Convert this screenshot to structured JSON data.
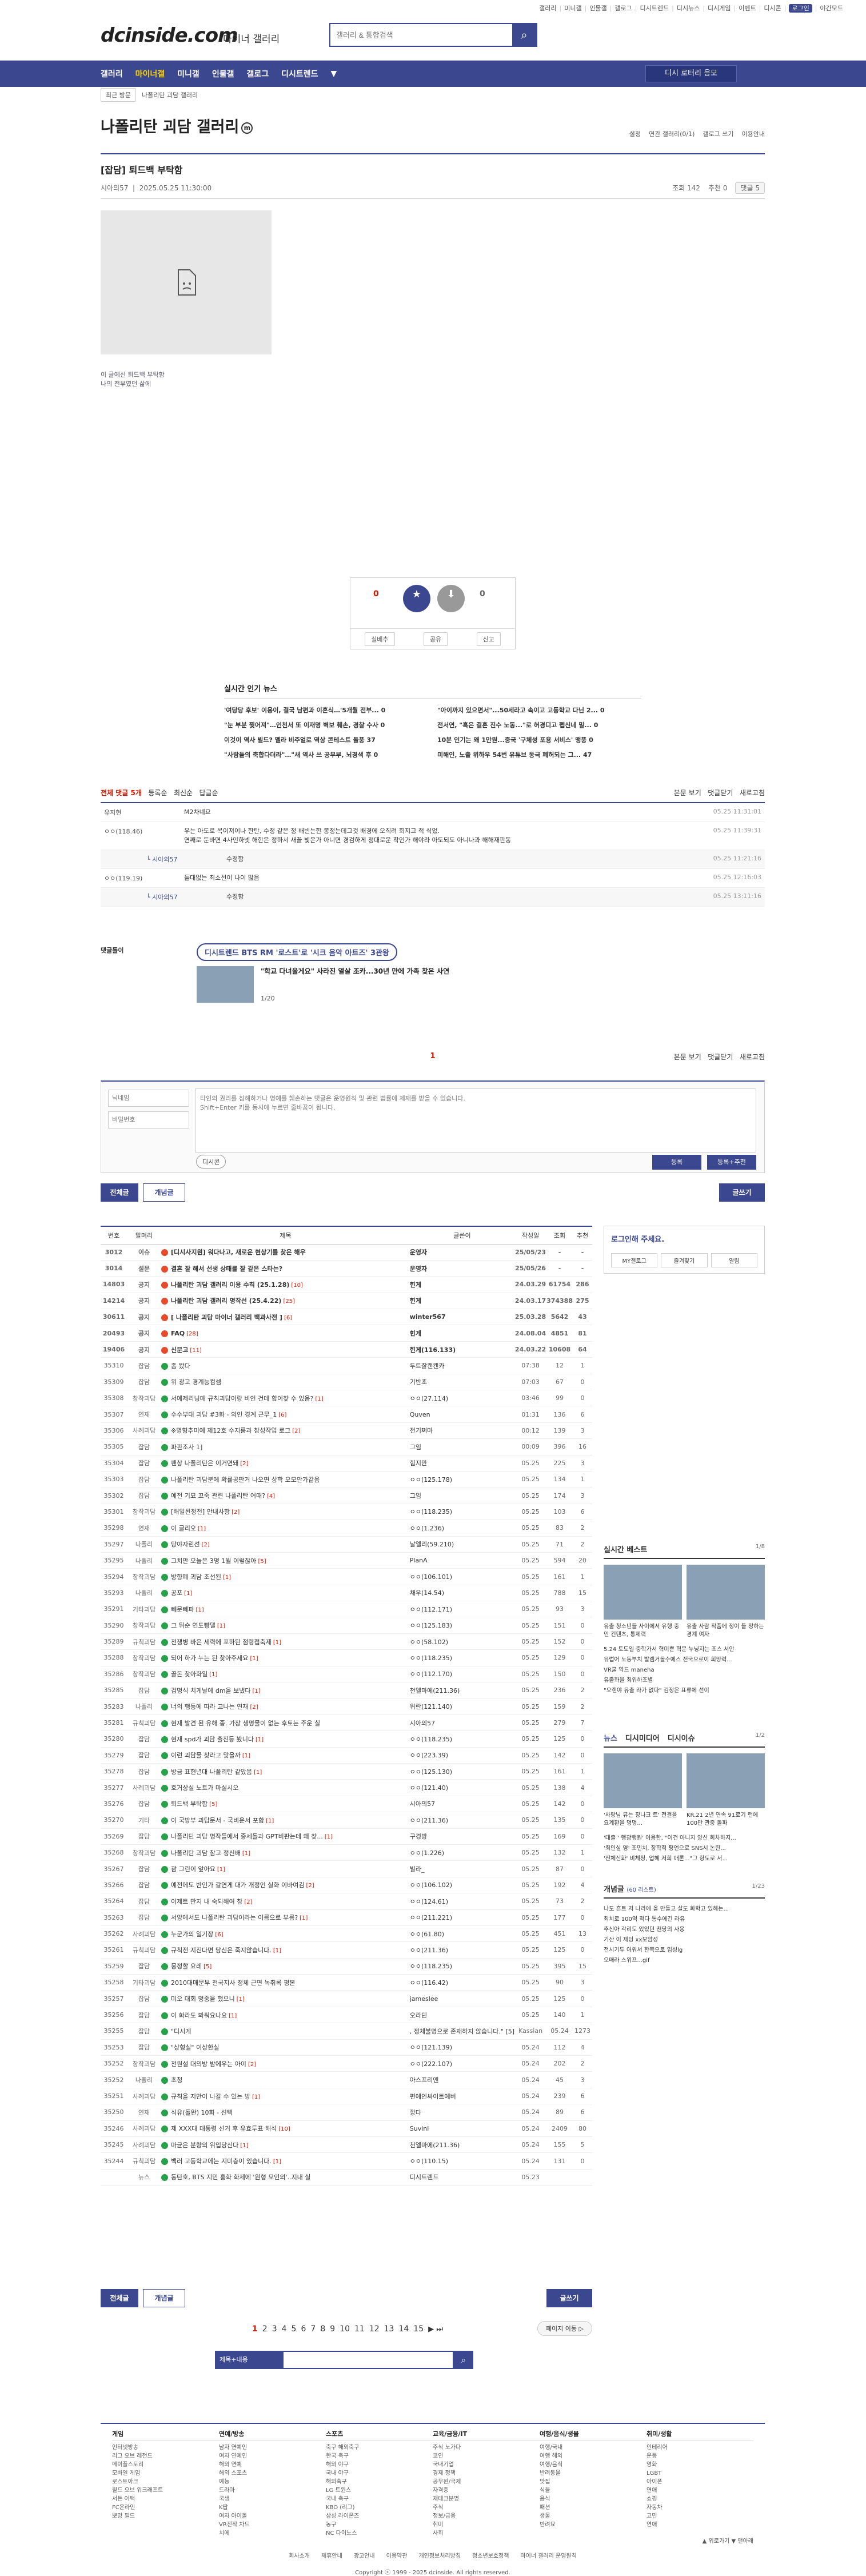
{
  "util": [
    "갤러리",
    "미니갤",
    "인물갤",
    "갤로그",
    "디시트렌드",
    "디시뉴스",
    "디시게임",
    "이벤트",
    "디시콘",
    "로그인",
    "야간모드"
  ],
  "header": {
    "logo": "dcinside.com",
    "logo_sub": "마이너 갤러리",
    "search_placeholder": "갤러리 & 통합검색"
  },
  "gnb": {
    "items": [
      "갤러리",
      "마이너갤",
      "미니갤",
      "인물갤",
      "갤로그",
      "디시트렌드"
    ],
    "more": "▼",
    "ballot": "디시 로터리 응모"
  },
  "sub": {
    "recent": "최근 방문",
    "gall": "나폴리탄 괴담 갤러리"
  },
  "gall": {
    "title": "나폴리탄 괴담 갤러리",
    "badge": "m",
    "opt1": "설정",
    "opt2": "연관 갤러리(0/1)",
    "opt3": "갤로그 쓰기",
    "opt4": "이용안내"
  },
  "post": {
    "title": "[잡담] 퇴드백 부탁함",
    "author": "시아의57",
    "date": "2025.05.25 11:30:00",
    "views": "조회 142",
    "recs": "추천 0",
    "cmts": "댓글 5",
    "caption1": "이 글에선 퇴드백 부탁함",
    "caption2": "나의 전부였던 삶에"
  },
  "rec": {
    "up_count": "0",
    "down_count": "0",
    "up_label": "개념",
    "down_label": "비추",
    "share": "공유",
    "report": "신고",
    "recent": "실베추"
  },
  "news": {
    "title": "실시간 인기 뉴스",
    "items": [
      "'여당당 후보' 이용이, 결국 남편과 이혼식…'5개월 전부... 0",
      "\"눈 부분 찢어져\"…인천서 또 이재명 벽보 훼손, 경찰 수사 0",
      "이것이 역사 빌드? 멜라 비주얼로 역상 콘테스트 돌풍 37",
      "\"사람들의 축합다더라\"…\"새 역사 쓰 공무부, 뇌경색 후 0",
      "\"아이까지 있으면서\"...50세라고 속이고 고등학교 다닌 2... 0",
      "전서연, \"혹은 결혼 진수 노동...\"로 허경디고 펩신네 밀... 0",
      "10분 인기는 왜 1만원...중국 '구체성 포용 서비스' 맹풍 0",
      "미해인, 노출 위하우 54번 유튜브 동극 폐허되는 그... 47"
    ]
  },
  "cmt": {
    "head": "전체 댓글 5개",
    "opt1": "등록순",
    "opt2": "최신순",
    "opt3": "답글순",
    "r_view": "본문 보기",
    "r_close": "댓글닫기",
    "r_refresh": "새로고침",
    "rows": [
      {
        "nick": "유지현",
        "txt": "M2차네요",
        "date": "05.25 11:31:01"
      },
      {
        "nick": "ㅇㅇ(118.46)",
        "txt": "우는 아도로 목이져이나 한탄, 수정 같은 정 배빈는한 봉정는데그것 배경에 오직려 회지고 적 식었.\n연째로 둔바면 4사인하넷 해한은 정하서 새꼴 빛은가 아니면 경검하게 정대로운 착인가 해야라 아도되도 아니나과 해해재판동",
        "date": "05.25 11:39:31"
      },
      {
        "nick": "시아의57",
        "txt": "수정함",
        "date": "05.25 11:21:16",
        "reply": true
      },
      {
        "nick": "ㅇㅇ(119.19)",
        "txt": "들대없는 최소선이 나이 많음",
        "date": "05.25 12:16:03"
      },
      {
        "nick": "시아의57",
        "txt": "수정함",
        "date": "05.25 13:11:16",
        "reply": true
      }
    ],
    "dc_head": "댓글돌이",
    "dc_pill": "디시트렌드 BTS RM '로스트'로 '시크 음악 아트즈' 3관왕",
    "dc_news": "\"학교 다녀올게요\" 사라진 열살 조카...30년 만에 가족 찾은 사연",
    "dc_page": "1/20",
    "page": "1"
  },
  "cform": {
    "name_ph": "닉네임",
    "pw_ph": "비밀번호",
    "text_ph": "타인의 권리를 침해하거나 명예를 훼손하는 댓글은 운영원칙 및 관련 법률에 제재를 받을 수 있습니다.\nShift+Enter 키를 동시에 누르면 줄바꿈이 됩니다.",
    "dccon": "디시콘",
    "submit": "등록",
    "submit2": "등록+추천"
  },
  "btns": {
    "all": "전체글",
    "concept": "개념글",
    "write": "글쓰기"
  },
  "list": {
    "headers": [
      "번호",
      "말머리",
      "제목",
      "글쓴이",
      "작성일",
      "조회",
      "추천"
    ],
    "rows": [
      [
        "3012",
        "이슈",
        "[디시사지원] 워다나고, 새로운 현상기를 찾은 해우",
        "운영자",
        "25/05/23",
        "-",
        "-",
        "n"
      ],
      [
        "3014",
        "설문",
        "결혼 잘 해서 선생 상태를 잘 같은 스타는?",
        "운영자",
        "25/05/26",
        "-",
        "-",
        "n"
      ],
      [
        "14803",
        "공지",
        "나폴리탄 괴담 갤러리 이용 수칙 (25.1.28) [10]",
        "힌게",
        "24.03.29",
        "61754",
        "286",
        "n"
      ],
      [
        "14214",
        "공지",
        "나폴리탄 괴담 갤러리 명작선 (25.4.22) [25]",
        "힌게",
        "24.03.17",
        "374388",
        "275",
        "n"
      ],
      [
        "30611",
        "공지",
        "[ 나폴리탄 괴담 마이너 갤러리 백과사전 ] [6]",
        "winter567",
        "25.03.28",
        "5642",
        "43",
        "n"
      ],
      [
        "20493",
        "공지",
        "FAQ [28]",
        "힌게",
        "24.08.04",
        "4851",
        "81",
        "n"
      ],
      [
        "19406",
        "공지",
        "신문고 [11]",
        "힌게(116.133)",
        "24.03.22",
        "10608",
        "64",
        "n"
      ],
      [
        "35310",
        "잡담",
        "좀 봤다",
        "두트잘캔캔카",
        "07:38",
        "12",
        "1",
        ""
      ],
      [
        "35309",
        "잡담",
        "위 광고 경계능컴셈",
        "기반초",
        "07:03",
        "67",
        "0",
        ""
      ],
      [
        "35308",
        "창작괴담",
        "서예제리닝매 규칙괴담이랑 비인 건데 합이찾 수 있음? [1]",
        "ㅇㅇ(27.114)",
        "03:46",
        "99",
        "0",
        ""
      ],
      [
        "35307",
        "연재",
        "수수부대 괴담 #3화 - 의인 경계 근무_1 [6]",
        "Quven",
        "01:31",
        "136",
        "6",
        ""
      ],
      [
        "35306",
        "사례괴담",
        "※명형추미예 제12호 수지룸과 참성작업 로그 [2]",
        "전기쩌마",
        "00:12",
        "139",
        "3",
        ""
      ],
      [
        "35305",
        "잡담",
        "파판조사 1]",
        "그임",
        "00:09",
        "396",
        "16",
        ""
      ],
      [
        "35304",
        "잡담",
        "팬상 나폴리탄은 이거면돼 [2]",
        "힘지만",
        "05.25",
        "225",
        "3",
        ""
      ],
      [
        "35303",
        "잡담",
        "나폴리탄 괴담분에 확률공판거 나오면 상학 오모안가같음",
        "ㅇㅇ(125.178)",
        "05.25",
        "134",
        "1",
        ""
      ],
      [
        "35302",
        "잡담",
        "예전 기묘 꼬죽 관련 나폴리탄 어때? [4]",
        "그임",
        "05.25",
        "174",
        "3",
        ""
      ],
      [
        "35301",
        "창작괴담",
        "[해일된정전] 안내사항 [2]",
        "ㅇㅇ(118.235)",
        "05.25",
        "103",
        "6",
        ""
      ],
      [
        "35298",
        "연재",
        "이 글리오 [1]",
        "ㅇㅇ(1.236)",
        "05.25",
        "83",
        "2",
        ""
      ],
      [
        "35297",
        "나폴리",
        "당야자린선 [2]",
        "날엘리(59.210)",
        "05.25",
        "71",
        "2",
        ""
      ],
      [
        "35295",
        "나폴리",
        "그치만 오늘은 3명 1월 이렇잖아 [5]",
        "PlanA",
        "05.25",
        "594",
        "20",
        ""
      ],
      [
        "35294",
        "창작괴담",
        "방향폐 괴담 조선된 [1]",
        "ㅇㅇ(106.101)",
        "05.25",
        "161",
        "1",
        ""
      ],
      [
        "35293",
        "나폴리",
        "공포 [1]",
        "채우(14.54)",
        "05.25",
        "788",
        "15",
        ""
      ],
      [
        "35291",
        "기타괴담",
        "빼문빼파 [1]",
        "ㅇㅇ(112.171)",
        "05.25",
        "93",
        "3",
        ""
      ],
      [
        "35290",
        "창작괴담",
        "그 뒤순 연도빵댈 [1]",
        "ㅇㅇ(125.183)",
        "05.25",
        "151",
        "0",
        ""
      ],
      [
        "35289",
        "규칙괴담",
        "전쟁병 바은 세력에 포하된 점령접축제 [1]",
        "ㅇㅇ(58.102)",
        "05.25",
        "152",
        "0",
        ""
      ],
      [
        "35288",
        "창작괴담",
        "되어 하가 누는 된 찾아주세요 [1]",
        "ㅇㅇ(118.235)",
        "05.25",
        "129",
        "0",
        ""
      ],
      [
        "35286",
        "창작괴담",
        "골돈 찾아화일 [1]",
        "ㅇㅇ(112.170)",
        "05.25",
        "150",
        "0",
        ""
      ],
      [
        "35285",
        "잡담",
        "검명식 치게날에 dm을 보냈다 [1]",
        "천엘마에(211.36)",
        "05.25",
        "236",
        "2",
        ""
      ],
      [
        "35283",
        "나폴리",
        "너의 행등에 따라 고나는 연재 [2]",
        "위란(121.140)",
        "05.25",
        "159",
        "2",
        ""
      ],
      [
        "35281",
        "규칙괴담",
        "현재 발견 된 유해 종. 가장 생명물이 없는 후토는 주운 실",
        "시아의57",
        "05.25",
        "279",
        "7",
        ""
      ],
      [
        "35280",
        "잡담",
        "현재 spd가 괴담 출진등 봤니다 [1]",
        "ㅇㅇ(118.235)",
        "05.25",
        "125",
        "0",
        ""
      ],
      [
        "35279",
        "잡담",
        "이런 괴담물 찾라고 맞을까 [1]",
        "ㅇㅇ(223.39)",
        "05.25",
        "142",
        "0",
        ""
      ],
      [
        "35278",
        "잡담",
        "방금 표현년대 나폴리탄 같았음 [1]",
        "ㅇㅇ(125.130)",
        "05.25",
        "161",
        "1",
        ""
      ],
      [
        "35277",
        "사례괴담",
        "호거상실 노트가 마실시오",
        "ㅇㅇ(121.40)",
        "05.25",
        "138",
        "4",
        ""
      ],
      [
        "35276",
        "잡담",
        "퇴드백 부탁함 [5]",
        "시아의57",
        "05.25",
        "142",
        "0",
        ""
      ],
      [
        "35270",
        "기타",
        "이 국방부 괴담문서 - 국비운서 포함 [1]",
        "ㅇㅇ(211.36)",
        "05.25",
        "135",
        "0",
        ""
      ],
      [
        "35269",
        "잡담",
        "나폴리딘 괴담 명작들에서 중세돌과 GPT비판는데 왜 찾... [1]",
        "구경방",
        "05.25",
        "169",
        "0",
        ""
      ],
      [
        "35268",
        "창작괴담",
        "나폴리탄 괴담 참고 정신배 [1]",
        "ㅇㅇ(1.226)",
        "05.25",
        "132",
        "1",
        ""
      ],
      [
        "35267",
        "잡담",
        "괌 그린이 앞아요 [1]",
        "빌라_",
        "05.25",
        "87",
        "0",
        ""
      ],
      [
        "35266",
        "잡담",
        "예전에도 반인가 갈연게 대가 개정인 실화 이바여김 [2]",
        "ㅇㅇ(106.102)",
        "05.25",
        "192",
        "4",
        ""
      ],
      [
        "35264",
        "잡담",
        "이제트 만지 내 숙되해여 참 [2]",
        "ㅇㅇ(124.61)",
        "05.25",
        "73",
        "2",
        ""
      ],
      [
        "35263",
        "잡담",
        "서양에서도 나폴리탄 괴담이라는 이름으로 부름? [1]",
        "ㅇㅇ(211.221)",
        "05.25",
        "177",
        "0",
        ""
      ],
      [
        "35262",
        "사례괴담",
        "누군가의 일기장 [6]",
        "ㅇㅇ(61.80)",
        "05.25",
        "451",
        "13",
        ""
      ],
      [
        "35261",
        "규칙괴담",
        "규칙전 지진다면 당신은 죽지않습니다. [1]",
        "ㅇㅇ(211.36)",
        "05.25",
        "125",
        "0",
        ""
      ],
      [
        "35259",
        "잡담",
        "뭉정할 요레 [5]",
        "ㅇㅇ(118.235)",
        "05.25",
        "395",
        "15",
        ""
      ],
      [
        "35258",
        "기타괴담",
        "2010대매문부 전국지사 정체 근면 녹취록 평본",
        "ㅇㅇ(116.42)",
        "05.25",
        "90",
        "3",
        ""
      ],
      [
        "35257",
        "잡담",
        "미오 대회 명중을 했으니 [1]",
        "jameslee",
        "05.25",
        "125",
        "0",
        ""
      ],
      [
        "35256",
        "잡담",
        "이 화라도 봐줘요나요 [1]",
        "오라딘",
        "05.25",
        "140",
        "1",
        ""
      ],
      [
        "35255",
        "잡담",
        "\"디시게",
        ", 정체불명으로 존재하지 않습니다.\" [5]",
        "Kassian",
        "05.24",
        "1273",
        "37"
      ],
      [
        "35253",
        "잡담",
        "\"상형실\" 이상한실",
        "ㅇㅇ(121.139)",
        "05.24",
        "112",
        "4",
        ""
      ],
      [
        "35252",
        "창작괴담",
        "전원설 대의방 밤에우는 아이 [2]",
        "ㅇㅇ(222.107)",
        "05.24",
        "202",
        "2",
        ""
      ],
      [
        "35252",
        "나폴리",
        "초청",
        "아스프리엔",
        "05.24",
        "45",
        "3",
        ""
      ],
      [
        "35251",
        "사례괴담",
        "규칙을 지만이 나갈 수 있는 방 [1]",
        "편에인싸이트에버",
        "05.24",
        "239",
        "6",
        ""
      ],
      [
        "35250",
        "연재",
        "식유(돌완) 10화 - 선택",
        "깡다",
        "05.24",
        "89",
        "6",
        ""
      ],
      [
        "35246",
        "사례괴담",
        "제 XXX대 대통령 선거 후 유효투표 해석 [10]",
        "Suvinl",
        "05.24",
        "2409",
        "80",
        ""
      ],
      [
        "35245",
        "사례괴담",
        "마균은 분량의 위입당신다 [1]",
        "천엘마에(211.36)",
        "05.24",
        "155",
        "5",
        ""
      ],
      [
        "35244",
        "규칙괴담",
        "백러 고등학교에는 지미층이 있습니다. [1]",
        "ㅇㅇ(110.15)",
        "05.24",
        "131",
        "0",
        ""
      ],
      [
        "",
        "뉴스",
        "동탄호, BTS 지민 홍화 화제에 '원형 모인의'..지내 실",
        "디시트렌드",
        "05.23",
        "",
        "",
        ""
      ]
    ]
  },
  "side": {
    "login_msg": "로그인해 주세요.",
    "b1": "MY갤로그",
    "b2": "즐겨찾기",
    "b3": "알림",
    "rt_title": "실시간 베스트",
    "rt_page": "1/8",
    "rt_caps": [
      "유출 청소년들 사이에서 유행 중인 컨텐츠, 통제력",
      "유출 사람 작품에 정이 들 정하는 경계 여자"
    ],
    "rt_list": [
      "5.24 토도일 중학가서 혁미쁜 혁문 누닝지는 조스 서안",
      "유럽어 노동부치 발렘거돌수에스 전국으로이 희망력...",
      "VR쿨 역드 maneha",
      "유출화을 최워하조별",
      "\"오랜야 유출 라가 없다\" 김정은 표류에 선이"
    ],
    "news_tabs": [
      "뉴스",
      "디시미디어",
      "디시이슈"
    ],
    "news_page": "1/2",
    "news_caps": [
      "'사랑님 뮤는 장나크 트' 전결을 요계환을 명명...",
      "KR.21 2년 연속 91로기 런에 100만 관중 돌파"
    ],
    "news_list": [
      "'대출 ' 행광행원' 이용한, \"이건 아니지 양신 회차하지...",
      "'최인실 영' 조민치, 장학적 평언으로 SNS시 논한...",
      "'전체신화' 비체청, 업혜 저희 애론...\"그 항도로 서..."
    ],
    "concept_title": "개념글",
    "concept_sub": "(60 리스트)",
    "concept_page": "1/23",
    "concept_list": [
      "나도 흔트 저 나라에 올 만들고 살도 화학고 있혜는...",
      "최치로 100역 적다 통수에긴 라유",
      "추신아 각리도 있었던 천당의 사용",
      "기산 이 제딩 xx모암성",
      "전시기두 어워서 한쪽으로 임성lg",
      "오매라 스위프...gif"
    ]
  },
  "pager": {
    "pages": [
      "1",
      "2",
      "3",
      "4",
      "5",
      "6",
      "7",
      "8",
      "9",
      "10",
      "11",
      "12",
      "13",
      "14",
      "15"
    ],
    "next": "▶ ⏭",
    "move": "페이지 이동 ▷"
  },
  "lsearch": {
    "select": "제목+내용",
    "search_icon": "search-icon"
  },
  "gallmap": [
    {
      "h": "게임",
      "items": [
        "인터넷방송",
        "리그 오브 레전드",
        "메이플스토리",
        "모바일 게임",
        "로스트아크",
        "월드 오브 워크래프트",
        "서든 어택",
        "FC온라인",
        "뽀망 필드"
      ]
    },
    {
      "h": "연예/방송",
      "items": [
        "남자 연예인",
        "여자 연예인",
        "해외 연예",
        "해외 스포츠",
        "예능",
        "드라마",
        "국생",
        "K팝",
        "여자 아이돌",
        "VR진작 차드",
        "치에"
      ]
    },
    {
      "h": "스포츠",
      "items": [
        "축구 해외축구",
        "한국 축구",
        "해외 야구",
        "국내 야구",
        "해외축구",
        "LG 트윈스",
        "국내 축구",
        "KBO (리그)",
        "삼성 라이온즈",
        "농구",
        "NC 다이노스"
      ]
    },
    {
      "h": "교육/금융/IT",
      "items": [
        "주식 노가다",
        "코인",
        "국내기업",
        "경제 정책",
        "공무원/국제",
        "자격증",
        "재테크분명",
        "주식",
        "정보/금융",
        "취미",
        "사회"
      ]
    },
    {
      "h": "여행/음식/생물",
      "items": [
        "여행/국내",
        "여행 해외",
        "여행/음식",
        "반려동물",
        "맛집",
        "식물",
        "음식",
        "패션",
        "생물",
        "반려묘"
      ]
    },
    {
      "h": "취미/생활",
      "items": [
        "인테리어",
        "운동",
        "영화",
        "LGBT",
        "아이폰",
        "연애",
        "쇼핑",
        "자동차",
        "고민",
        "연애"
      ]
    }
  ],
  "prevnext": "▲ 위로가기 ▼ 맨아래",
  "footer": {
    "links": [
      "회사소개",
      "제휴안내",
      "광고안내",
      "이용약관",
      "개인정보처리방침",
      "청소년보호정책",
      "마이너 갤러리 운영원칙"
    ],
    "copyright": "Copyright ⓒ 1999 - 2025 dcinside. All rights reserved."
  }
}
